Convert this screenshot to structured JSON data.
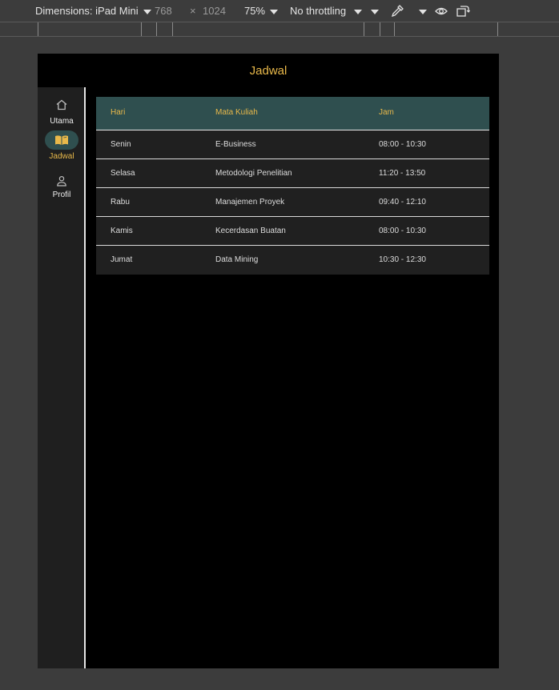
{
  "devtools": {
    "dimensions_label": "Dimensions: iPad Mini",
    "width": "768",
    "times": "×",
    "height": "1024",
    "zoom": "75%",
    "throttling": "No throttling"
  },
  "app": {
    "title": "Jadwal"
  },
  "nav": {
    "items": [
      {
        "label": "Utama",
        "icon": "home-icon",
        "active": false
      },
      {
        "label": "Jadwal",
        "icon": "book-icon",
        "active": true
      },
      {
        "label": "Profil",
        "icon": "person-icon",
        "active": false
      }
    ]
  },
  "table": {
    "headers": [
      "Hari",
      "Mata Kuliah",
      "Jam"
    ],
    "rows": [
      [
        "Senin",
        "E-Business",
        "08:00 - 10:30"
      ],
      [
        "Selasa",
        "Metodologi Penelitian",
        "11:20 - 13:50"
      ],
      [
        "Rabu",
        "Manajemen Proyek",
        "09:40 - 12:10"
      ],
      [
        "Kamis",
        "Kecerdasan Buatan",
        "08:00 - 10:30"
      ],
      [
        "Jumat",
        "Data Mining",
        "10:30 - 12:30"
      ]
    ]
  },
  "colors": {
    "accent": "#e8b84a",
    "header_bg": "#2f4f4f",
    "row_bg": "#202020",
    "page_bg": "#000000"
  }
}
